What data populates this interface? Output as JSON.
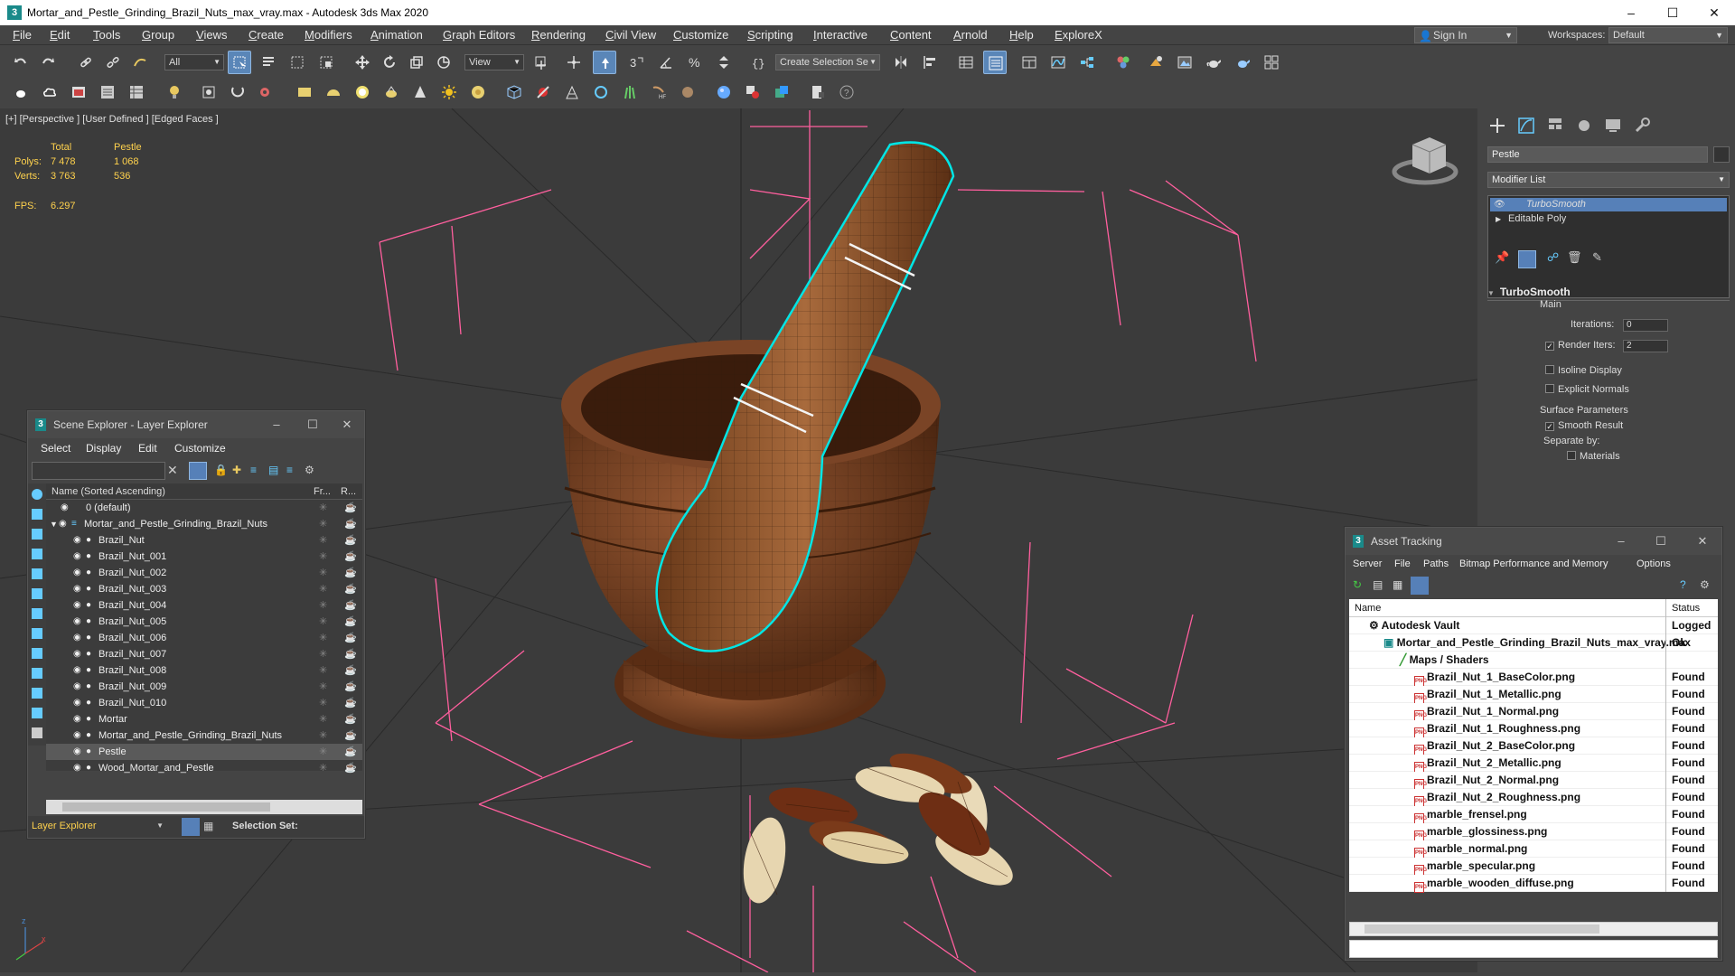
{
  "window": {
    "title": "Mortar_and_Pestle_Grinding_Brazil_Nuts_max_vray.max - Autodesk 3ds Max 2020",
    "app_icon": "3"
  },
  "menu": [
    "File",
    "Edit",
    "Tools",
    "Group",
    "Views",
    "Create",
    "Modifiers",
    "Animation",
    "Graph Editors",
    "Rendering",
    "Civil View",
    "Customize",
    "Scripting",
    "Interactive",
    "Content",
    "Arnold",
    "Help",
    "ExploreX"
  ],
  "signin": "Sign In",
  "workspaces": {
    "label": "Workspaces:",
    "value": "Default"
  },
  "toolbar": {
    "filter": "All",
    "ref_coord": "View",
    "selection_set": "Create Selection Se"
  },
  "viewport": {
    "label": "[+] [Perspective ] [User Defined ] [Edged Faces ]",
    "stats": {
      "col_total": "Total",
      "col_sel": "Pestle",
      "polys_label": "Polys:",
      "polys_total": "7 478",
      "polys_sel": "1 068",
      "verts_label": "Verts:",
      "verts_total": "3 763",
      "verts_sel": "536",
      "fps_label": "FPS:",
      "fps": "6.297"
    }
  },
  "command_panel": {
    "object_name": "Pestle",
    "modifier_list": "Modifier List",
    "stack": [
      "TurboSmooth",
      "Editable Poly"
    ],
    "rollout": "TurboSmooth",
    "main": "Main",
    "iterations_label": "Iterations:",
    "iterations": "0",
    "render_iters_label": "Render Iters:",
    "render_iters": "2",
    "isoline": "Isoline Display",
    "explicit": "Explicit Normals",
    "surface": "Surface Parameters",
    "smooth": "Smooth Result",
    "separate": "Separate by:",
    "materials": "Materials"
  },
  "scene_explorer": {
    "title": "Scene Explorer - Layer Explorer",
    "menu": [
      "Select",
      "Display",
      "Edit",
      "Customize"
    ],
    "col_name": "Name (Sorted Ascending)",
    "col_fr": "Fr...",
    "col_r": "R...",
    "rows": [
      {
        "label": "0 (default)",
        "indent": 0
      },
      {
        "label": "Mortar_and_Pestle_Grinding_Brazil_Nuts",
        "indent": 1
      },
      {
        "label": "Brazil_Nut",
        "indent": 2
      },
      {
        "label": "Brazil_Nut_001",
        "indent": 2
      },
      {
        "label": "Brazil_Nut_002",
        "indent": 2
      },
      {
        "label": "Brazil_Nut_003",
        "indent": 2
      },
      {
        "label": "Brazil_Nut_004",
        "indent": 2
      },
      {
        "label": "Brazil_Nut_005",
        "indent": 2
      },
      {
        "label": "Brazil_Nut_006",
        "indent": 2
      },
      {
        "label": "Brazil_Nut_007",
        "indent": 2
      },
      {
        "label": "Brazil_Nut_008",
        "indent": 2
      },
      {
        "label": "Brazil_Nut_009",
        "indent": 2
      },
      {
        "label": "Brazil_Nut_010",
        "indent": 2
      },
      {
        "label": "Mortar",
        "indent": 2
      },
      {
        "label": "Mortar_and_Pestle_Grinding_Brazil_Nuts",
        "indent": 2
      },
      {
        "label": "Pestle",
        "indent": 2
      },
      {
        "label": "Wood_Mortar_and_Pestle",
        "indent": 2
      }
    ],
    "footer_label": "Layer Explorer",
    "selection_set": "Selection Set:"
  },
  "asset_tracking": {
    "title": "Asset Tracking",
    "menu": [
      "Server",
      "File",
      "Paths",
      "Bitmap Performance and Memory",
      "Options"
    ],
    "col_name": "Name",
    "col_status": "Status",
    "rows": [
      {
        "name": "Autodesk Vault",
        "status": "Logged O"
      },
      {
        "name": "Mortar_and_Pestle_Grinding_Brazil_Nuts_max_vray.max",
        "status": "Ok"
      },
      {
        "name": "Maps / Shaders",
        "status": ""
      },
      {
        "name": "Brazil_Nut_1_BaseColor.png",
        "status": "Found"
      },
      {
        "name": "Brazil_Nut_1_Metallic.png",
        "status": "Found"
      },
      {
        "name": "Brazil_Nut_1_Normal.png",
        "status": "Found"
      },
      {
        "name": "Brazil_Nut_1_Roughness.png",
        "status": "Found"
      },
      {
        "name": "Brazil_Nut_2_BaseColor.png",
        "status": "Found"
      },
      {
        "name": "Brazil_Nut_2_Metallic.png",
        "status": "Found"
      },
      {
        "name": "Brazil_Nut_2_Normal.png",
        "status": "Found"
      },
      {
        "name": "Brazil_Nut_2_Roughness.png",
        "status": "Found"
      },
      {
        "name": "marble_frensel.png",
        "status": "Found"
      },
      {
        "name": "marble_glossiness.png",
        "status": "Found"
      },
      {
        "name": "marble_normal.png",
        "status": "Found"
      },
      {
        "name": "marble_specular.png",
        "status": "Found"
      },
      {
        "name": "marble_wooden_diffuse.png",
        "status": "Found"
      }
    ]
  },
  "colors": {
    "accent": "#5680b8",
    "selection": "#00e5e5",
    "bbox": "#ff5f9e",
    "wood": "#7a4426"
  }
}
